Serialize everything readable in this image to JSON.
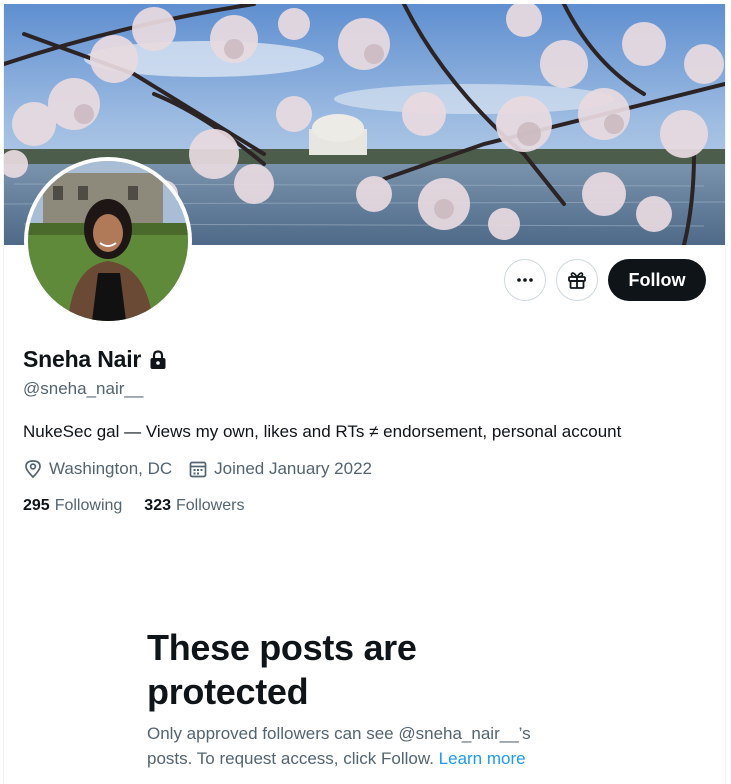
{
  "profile": {
    "name": "Sneha Nair",
    "handle": "@sneha_nair__",
    "bio": "NukeSec gal — Views my own, likes and RTs ≠ endorsement, personal account",
    "location": "Washington, DC",
    "joined": "Joined January 2022",
    "locked": true
  },
  "stats": {
    "following_count": "295",
    "following_label": "Following",
    "followers_count": "323",
    "followers_label": "Followers"
  },
  "actions": {
    "more_icon": "more-horizontal-icon",
    "subscribe_icon": "gift-icon",
    "follow_label": "Follow"
  },
  "protected": {
    "title": "These posts are protected",
    "text": "Only approved followers can see @sneha_nair__’s posts. To request access, click Follow.",
    "learn_more": "Learn more"
  },
  "colors": {
    "text_primary": "#0f1419",
    "text_secondary": "#536471",
    "link": "#1d9bf0",
    "follow_bg": "#0f1419"
  }
}
